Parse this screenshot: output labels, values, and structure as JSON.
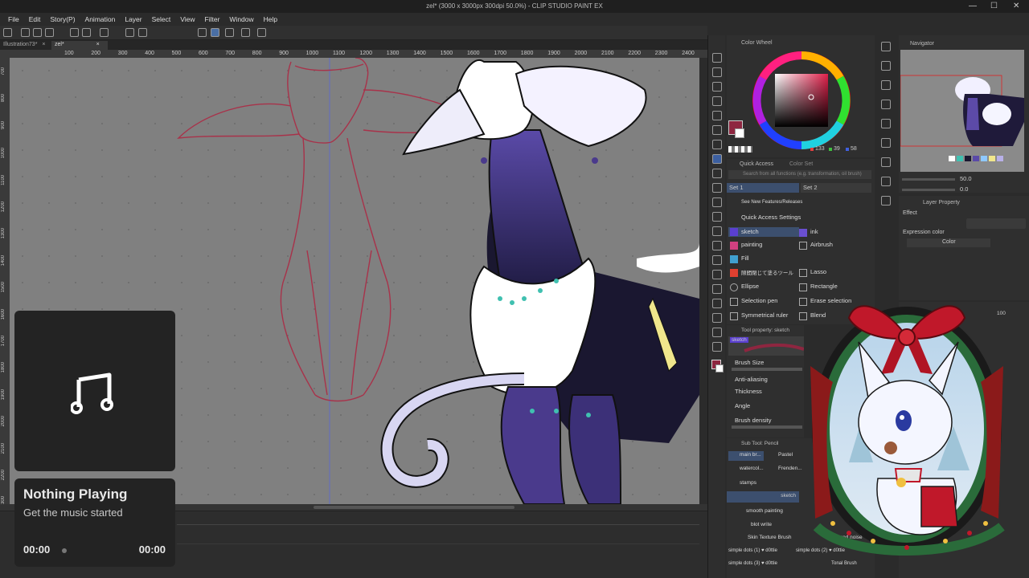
{
  "window": {
    "title": "zel* (3000 x 3000px 300dpi 50.0%) - CLIP STUDIO PAINT EX",
    "minimize": "—",
    "maximize": "☐",
    "close": "✕"
  },
  "menu": [
    "File",
    "Edit",
    "Story(P)",
    "Animation",
    "Layer",
    "Select",
    "View",
    "Filter",
    "Window",
    "Help"
  ],
  "tabs": [
    {
      "label": "Illustration73*",
      "close": "×"
    },
    {
      "label": "zel*",
      "close": "×"
    }
  ],
  "ruler_top_labels": [
    "100",
    "200",
    "300",
    "400",
    "500",
    "600",
    "700",
    "800",
    "900",
    "1000",
    "1100",
    "1200",
    "1300",
    "1400",
    "1500",
    "1600",
    "1700",
    "1800",
    "1900",
    "2000",
    "2100",
    "2200",
    "2300",
    "2400"
  ],
  "ruler_left_labels": [
    "700",
    "800",
    "900",
    "1000",
    "1100",
    "1200",
    "1300",
    "1400",
    "1500",
    "1600",
    "1700",
    "1800",
    "1900",
    "2000",
    "2100",
    "2200",
    "2300",
    "2400"
  ],
  "colors": {
    "main_color": "#8e2640",
    "rgb_values": [
      "133",
      "39",
      "58"
    ],
    "rgb_colors": [
      "#e04040",
      "#40c040",
      "#4060e0"
    ],
    "sketch_line": "#a8324a"
  },
  "color_wheel": {
    "title": "Color Wheel"
  },
  "quick_access": {
    "title": "Quick Access",
    "tab2": "Color Set",
    "search_placeholder": "Search from all functions (e.g. transformation, oil brush)",
    "set1": "Set 1",
    "set2": "Set 2",
    "see_new": "See New Features/Releases",
    "settings": "Quick Access Settings",
    "items_left": [
      "sketch",
      "painting",
      "Fill",
      "隙間閉じて塗るツール",
      "Ellipse",
      "Selection pen",
      "Symmetrical ruler"
    ],
    "items_right": [
      "ink",
      "Airbrush",
      "",
      "Lasso",
      "Rectangle",
      "Erase selection",
      "Blend"
    ]
  },
  "tool_property": {
    "title": "Tool property: sketch",
    "brush_name": "sketch",
    "props": [
      "Brush Size",
      "Anti-aliasing",
      "Thickness",
      "Angle",
      "Brush density"
    ]
  },
  "sub_tool": {
    "title": "Sub Tool: Pencil",
    "groups": [
      "main br...",
      "Pastel",
      "watercol...",
      "Frenden...",
      "stamps"
    ],
    "brushes": [
      "sketch",
      "smooth painting",
      "blot write",
      "Skin Texture Brush",
      "colored noise"
    ],
    "dots": [
      "simple dots (1) ♥ d0ttie",
      "simple dots (2) ♥ d0ttie",
      "simple dots (3) ♥ d0ttie",
      "Tonal Brush"
    ]
  },
  "navigator": {
    "title": "Navigator",
    "zoom": "50.0",
    "rotate": "0.0"
  },
  "layer_property": {
    "title": "Layer Property",
    "effect": "Effect",
    "expression_color": "Expression color",
    "color_option": "Color"
  },
  "opacity": "100",
  "music": {
    "title": "Nothing Playing",
    "subtitle": "Get the music started",
    "time_elapsed": "00:00",
    "time_total": "00:00",
    "icon": "music-note-icon"
  }
}
